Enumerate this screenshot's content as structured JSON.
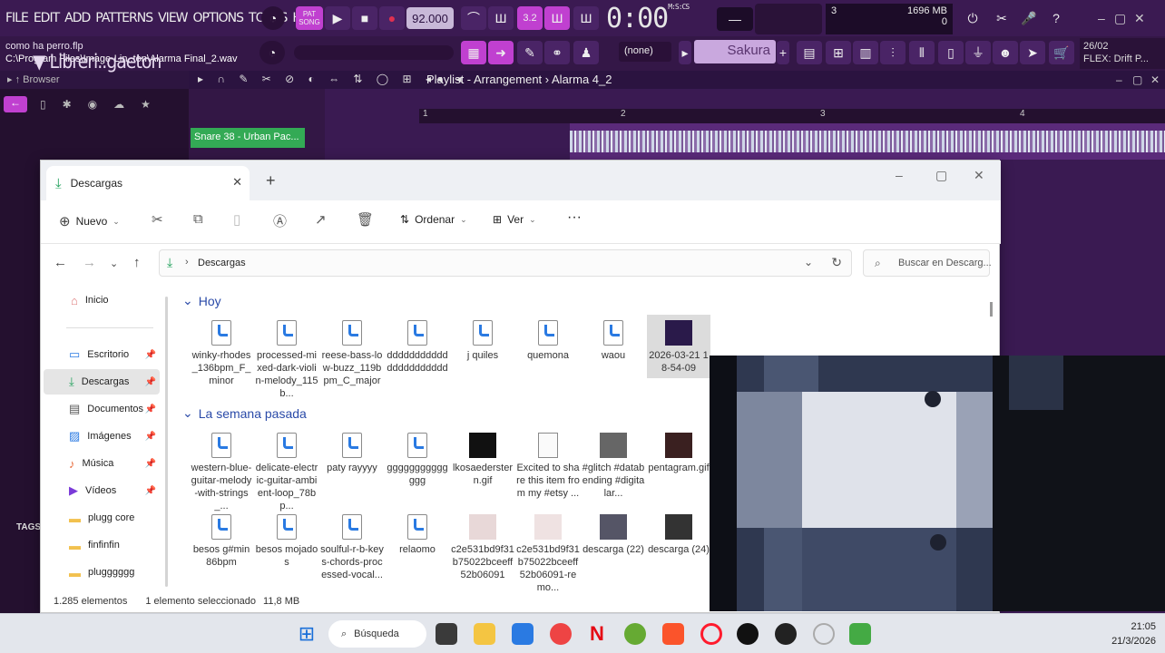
{
  "fl": {
    "menu": [
      "FILE",
      "EDIT",
      "ADD",
      "PATTERNS",
      "VIEW",
      "OPTIONS",
      "TOOLS",
      "HELP"
    ],
    "tempo": "92.000",
    "song_label": "SONG",
    "pat_label": "PAT",
    "time": "0:00",
    "time_suffix": "00",
    "time_unit": "M:S:CS",
    "cpu_num": "3",
    "mem": "1696 MB",
    "mem2": "0",
    "project_name": "como ha perro.flp",
    "project_path": "C:\\Program Files\\Image-Lin..ton\\Alarma Final_2.wav",
    "pattern_none": "(none)",
    "preset": "Sakura",
    "date_short": "26/02",
    "flex_label": "FLEX: Drift P...",
    "browser_label": "Browser",
    "browser_title": "Libreri..gaeton",
    "tags": "TAGS",
    "playlist_title": "Playlist - Arrangement",
    "playlist_pattern": "Alarma 4_2",
    "channel_snare": "Snare 38 - Urban Pac...",
    "ruler": [
      "1",
      "2",
      "3",
      "4"
    ]
  },
  "explorer": {
    "tab_title": "Descargas",
    "toolbar": {
      "new": "Nuevo",
      "sort": "Ordenar",
      "view": "Ver",
      "more": "···"
    },
    "address": "Descargas",
    "search_placeholder": "Buscar en Descarg...",
    "sidebar": [
      {
        "label": "Inicio",
        "icon": "home-icon",
        "pinned": false
      },
      {
        "label": "Escritorio",
        "icon": "desktop-icon",
        "pinned": true
      },
      {
        "label": "Descargas",
        "icon": "download-icon",
        "pinned": true,
        "selected": true
      },
      {
        "label": "Documentos",
        "icon": "documents-icon",
        "pinned": true
      },
      {
        "label": "Imágenes",
        "icon": "images-icon",
        "pinned": true
      },
      {
        "label": "Música",
        "icon": "music-icon",
        "pinned": true
      },
      {
        "label": "Vídeos",
        "icon": "videos-icon",
        "pinned": true
      },
      {
        "label": "plugg core",
        "icon": "folder-icon",
        "pinned": false
      },
      {
        "label": "finfinfin",
        "icon": "folder-icon",
        "pinned": false
      },
      {
        "label": "plugggggg",
        "icon": "folder-icon",
        "pinned": false
      }
    ],
    "groups": {
      "today": "Hoy",
      "last_week": "La semana pasada"
    },
    "files_today": [
      {
        "name": "winky-rhodes_136bpm_F_minor",
        "type": "wav"
      },
      {
        "name": "processed-mixed-dark-violin-melody_115b...",
        "type": "wav"
      },
      {
        "name": "reese-bass-low-buzz_119bpm_C_major",
        "type": "wav"
      },
      {
        "name": "dddddddddddddddddddddd",
        "type": "mp3"
      },
      {
        "name": "j quiles",
        "type": "wav"
      },
      {
        "name": "quemona",
        "type": "wav"
      },
      {
        "name": "waou",
        "type": "wav"
      },
      {
        "name": "2026-03-21 18-54-09",
        "type": "video",
        "selected": true
      }
    ],
    "files_week_row1": [
      {
        "name": "western-blue-guitar-melody-with-strings_...",
        "type": "wav"
      },
      {
        "name": "delicate-electric-guitar-ambient-loop_78bp...",
        "type": "mp3"
      },
      {
        "name": "paty rayyyy",
        "type": "wav"
      },
      {
        "name": "gggggggggggggg",
        "type": "wav"
      },
      {
        "name": "lkosaederstern.gif",
        "type": "gif"
      },
      {
        "name": "Excited to share this item from my #etsy ...",
        "type": "doc"
      },
      {
        "name": "#glitch #databending #digitalar...",
        "type": "image"
      },
      {
        "name": "pentagram.gif",
        "type": "gif2"
      }
    ],
    "files_week_row2": [
      {
        "name": "besos g#min 86bpm",
        "type": "wav"
      },
      {
        "name": "besos mojados",
        "type": "mp3"
      },
      {
        "name": "soulful-r-b-keys-chords-processed-vocal...",
        "type": "wav"
      },
      {
        "name": "relaomo",
        "type": "wav"
      },
      {
        "name": "c2e531bd9f31b75022bceeff52b06091",
        "type": "photo"
      },
      {
        "name": "c2e531bd9f31b75022bceeff52b06091-remo...",
        "type": "photo2"
      },
      {
        "name": "descarga (22)",
        "type": "photo3"
      },
      {
        "name": "descarga (24)",
        "type": "photo4"
      }
    ],
    "status": {
      "count": "1.285 elementos",
      "selected": "1 elemento seleccionado",
      "size": "11,8 MB"
    }
  },
  "taskbar": {
    "search": "Búsqueda",
    "time": "21:05",
    "date": "21/3/2026"
  },
  "colors": {
    "fl_bg": "#3b1a52",
    "accent_pink": "#c040d0",
    "explorer_blue": "#2a4aa8"
  }
}
